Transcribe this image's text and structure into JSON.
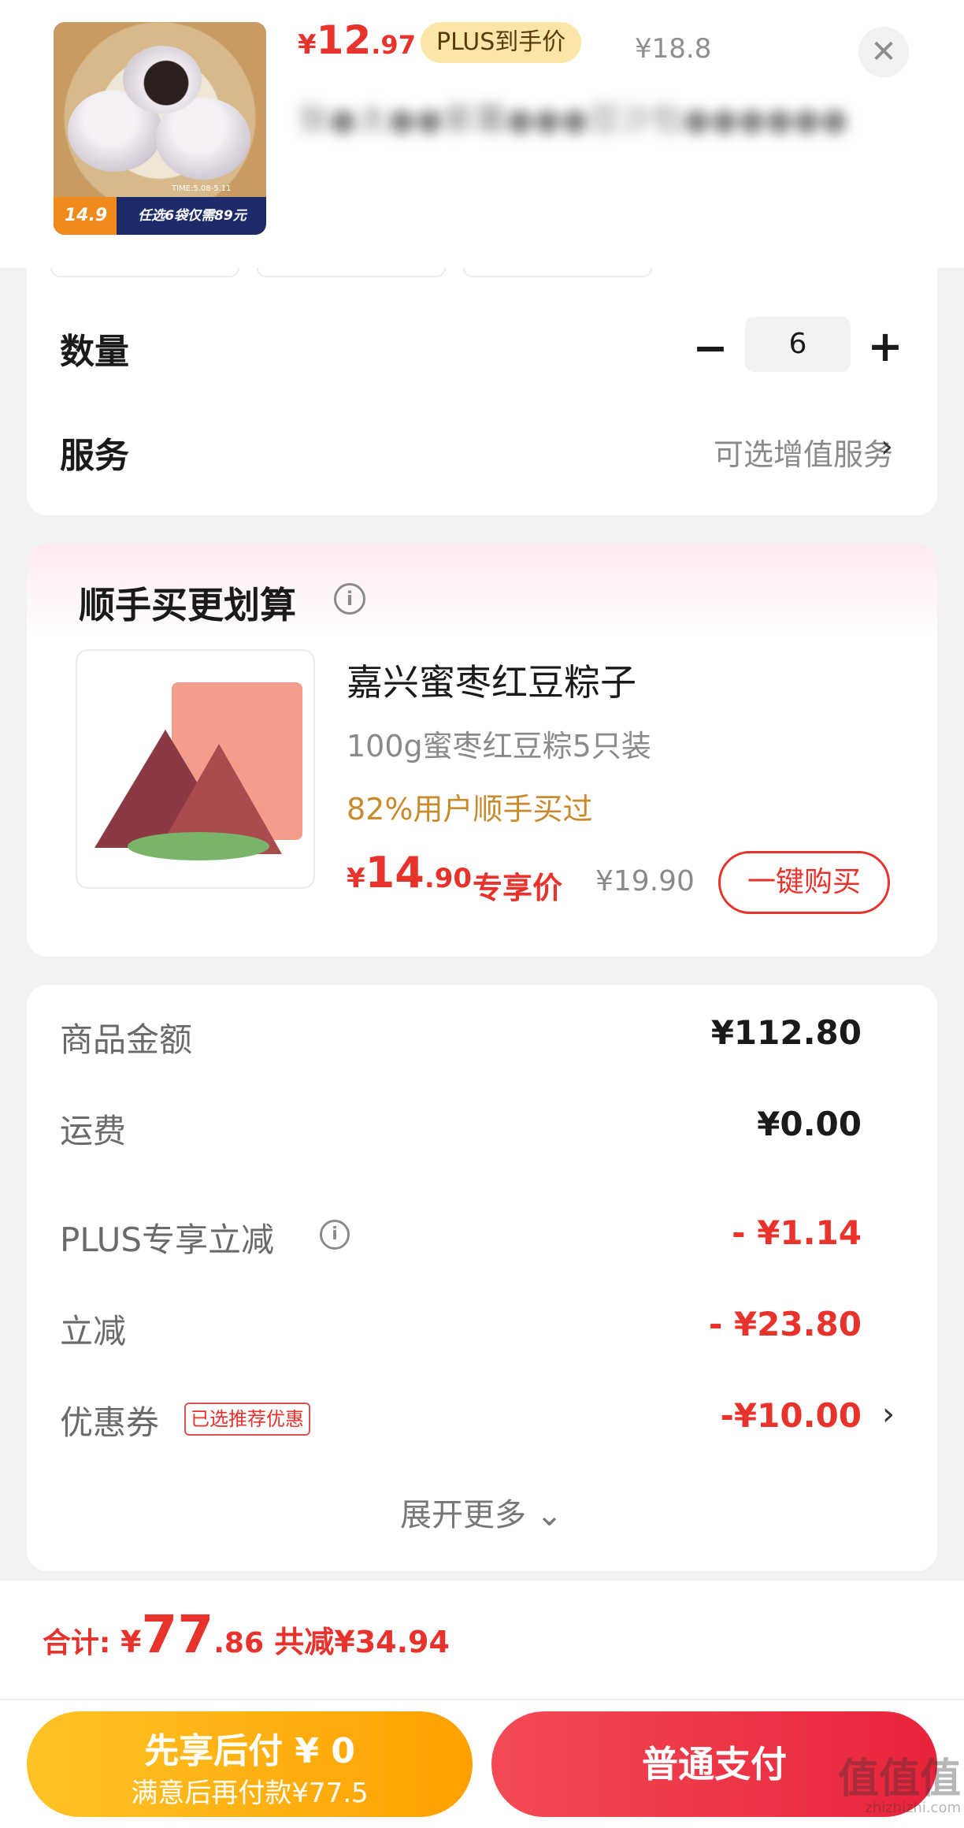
{
  "product": {
    "price_currency": "¥",
    "price_int": "12",
    "price_dec": ".97",
    "plus_badge": "PLUS到手价",
    "original_price": "¥18.8",
    "title_obscured": "张●太●●紫薯●●●豆沙包●●●●●●",
    "thumb_price": "14.9",
    "thumb_promo": "任选6袋仅需89元",
    "thumb_time": "TIME:5.08-5.11"
  },
  "options": {
    "quantity_label": "数量",
    "quantity_value": "6",
    "minus_symbol": "−",
    "plus_symbol": "+",
    "service_label": "服务",
    "service_value": "可选增值服务",
    "chevron": "›"
  },
  "upsell": {
    "title": "顺手买更划算",
    "info_symbol": "i",
    "name": "嘉兴蜜枣红豆粽子",
    "desc": "100g蜜枣红豆粽5只装",
    "social_proof": "82%用户顺手买过",
    "price_currency": "¥",
    "price_int": "14",
    "price_dec": ".90",
    "exclusive_label": "专享价",
    "original_price": "¥19.90",
    "buy_button": "一键购买"
  },
  "fees": {
    "rows": [
      {
        "label": "商品金额",
        "value": "¥112.80"
      },
      {
        "label": "运费",
        "value": "¥0.00"
      },
      {
        "label": "PLUS专享立减",
        "value": "- ¥1.14"
      },
      {
        "label": "立减",
        "value": "- ¥23.80"
      },
      {
        "label": "优惠券",
        "value": "-¥10.00"
      }
    ],
    "coupon_tag": "已选推荐优惠",
    "expand_more": "展开更多 ⌄"
  },
  "total": {
    "label": "合计: ",
    "currency": "¥",
    "int": "77",
    "dec": ".86",
    "saved": " 共减¥34.94"
  },
  "bottom": {
    "pay_later_main": "先享后付 ¥ 0",
    "pay_later_sub": "满意后再付款¥77.5",
    "pay_button": "普通支付"
  },
  "watermark": {
    "big": "值值值",
    "small": "zhizhizhi.com"
  },
  "colors": {
    "accent": "#e8322c",
    "plus_badge": "#fbe6a7",
    "pay_later": "#ffb300",
    "social_proof": "#c98a2e"
  },
  "icons": {
    "close": "close-icon",
    "info": "info-icon",
    "chevron": "chevron-right-icon",
    "expand": "chevron-down-icon"
  }
}
